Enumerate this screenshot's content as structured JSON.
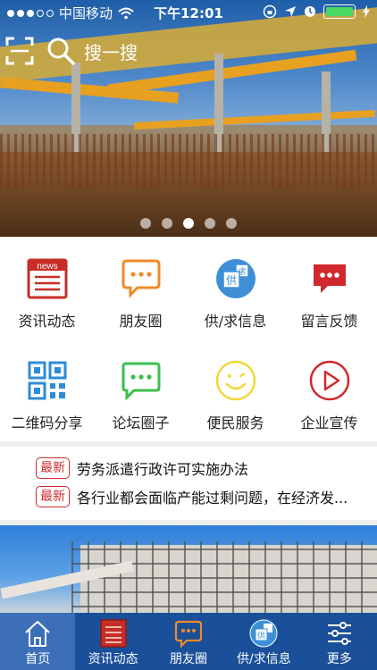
{
  "status_bar": {
    "carrier": "中国移动",
    "time": "下午12:01"
  },
  "search": {
    "placeholder": "搜一搜",
    "icon": "search-icon"
  },
  "carousel": {
    "slide_count": 5,
    "active_index": 2
  },
  "menu": [
    {
      "label": "资讯动态",
      "icon": "news-icon"
    },
    {
      "label": "朋友圈",
      "icon": "chat-bubble-icon"
    },
    {
      "label": "供/求信息",
      "icon": "supply-icon"
    },
    {
      "label": "留言反馈",
      "icon": "message-icon"
    },
    {
      "label": "二维码分享",
      "icon": "qr-code-icon"
    },
    {
      "label": "论坛圈子",
      "icon": "forum-icon"
    },
    {
      "label": "便民服务",
      "icon": "smiley-icon"
    },
    {
      "label": "企业宣传",
      "icon": "play-icon"
    }
  ],
  "news": {
    "badge": "最新",
    "items": [
      "劳务派遣行政许可实施办法",
      "各行业都会面临产能过剩问题，在经济发..."
    ]
  },
  "tabbar": [
    {
      "label": "首页",
      "icon": "home-icon"
    },
    {
      "label": "资讯动态",
      "icon": "news-icon"
    },
    {
      "label": "朋友圈",
      "icon": "chat-bubble-icon"
    },
    {
      "label": "供/求信息",
      "icon": "supply-icon"
    },
    {
      "label": "更多",
      "icon": "settings-sliders-icon"
    }
  ],
  "colors": {
    "tabbar": "#1a4f9a",
    "tabbar_active": "#3c6fb7",
    "accent_red": "#d0282e",
    "news_icon_red": "#c62d26",
    "chat_orange": "#f08a2a",
    "supply_blue": "#3f8fd6",
    "forum_green": "#3cbf4c",
    "smiley_yellow": "#f1d63a"
  }
}
